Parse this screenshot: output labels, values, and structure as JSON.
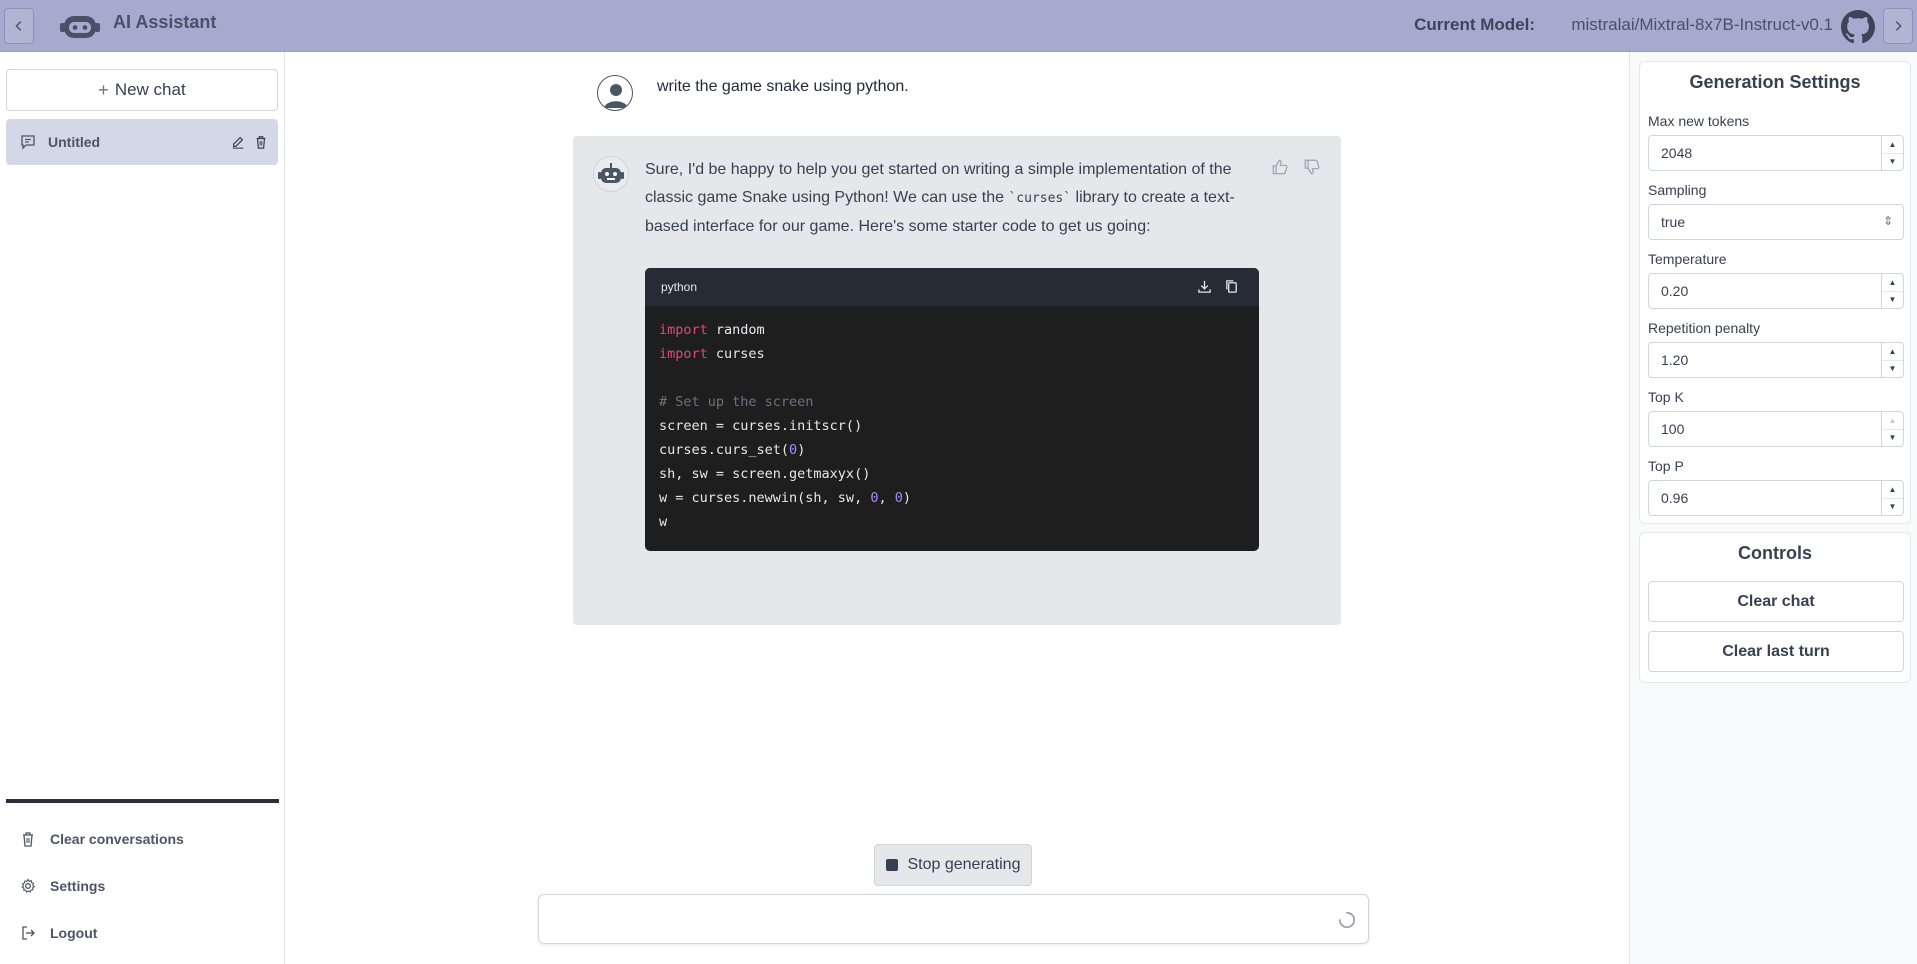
{
  "header": {
    "title": "AI Assistant",
    "model_label": "Current Model:",
    "model_value": "mistralai/Mixtral-8x7B-Instruct-v0.1"
  },
  "sidebar": {
    "new_chat": "New chat",
    "conversations": [
      {
        "title": "Untitled",
        "active": true
      }
    ],
    "footer": [
      {
        "label": "Clear conversations",
        "icon": "trash-icon"
      },
      {
        "label": "Settings",
        "icon": "gear-icon"
      },
      {
        "label": "Logout",
        "icon": "logout-icon"
      }
    ]
  },
  "chat": {
    "user_message": "write the game snake using python.",
    "assistant_text_1": "Sure, I'd be happy to help you get started on writing a simple implementation of the classic game Snake using Python! We can use the ",
    "assistant_code_inline": "`curses`",
    "assistant_text_2": " library to create a text-based interface for our game. Here's some starter code to get us going:",
    "code_language": "python",
    "code_lines": [
      [
        {
          "t": "import",
          "c": "kw"
        },
        {
          "t": " random",
          "c": ""
        }
      ],
      [
        {
          "t": "import",
          "c": "kw"
        },
        {
          "t": " curses",
          "c": ""
        }
      ],
      [],
      [
        {
          "t": "# Set up the screen",
          "c": "cm"
        }
      ],
      [
        {
          "t": "screen = curses.initscr()",
          "c": ""
        }
      ],
      [
        {
          "t": "curses.curs_set(",
          "c": ""
        },
        {
          "t": "0",
          "c": "num"
        },
        {
          "t": ")",
          "c": ""
        }
      ],
      [
        {
          "t": "sh, sw = screen.getmaxyx()",
          "c": ""
        }
      ],
      [
        {
          "t": "w = curses.newwin(sh, sw, ",
          "c": ""
        },
        {
          "t": "0",
          "c": "num"
        },
        {
          "t": ", ",
          "c": ""
        },
        {
          "t": "0",
          "c": "num"
        },
        {
          "t": ")",
          "c": ""
        }
      ],
      [
        {
          "t": "w",
          "c": ""
        }
      ]
    ],
    "stop_label": "Stop generating",
    "input_value": "",
    "input_placeholder": ""
  },
  "settings": {
    "title": "Generation Settings",
    "max_new_tokens_label": "Max new tokens",
    "max_new_tokens": "2048",
    "sampling_label": "Sampling",
    "sampling": "true",
    "temperature_label": "Temperature",
    "temperature": "0.20",
    "repetition_penalty_label": "Repetition penalty",
    "repetition_penalty": "1.20",
    "top_k_label": "Top K",
    "top_k": "100",
    "top_p_label": "Top P",
    "top_p": "0.96"
  },
  "controls": {
    "title": "Controls",
    "clear_chat": "Clear chat",
    "clear_last_turn": "Clear last turn"
  },
  "colors": {
    "header_bg": "#a5abce",
    "active_chat_bg": "#d4d7e8",
    "keyword": "#e3477a",
    "number": "#a78bfa"
  }
}
